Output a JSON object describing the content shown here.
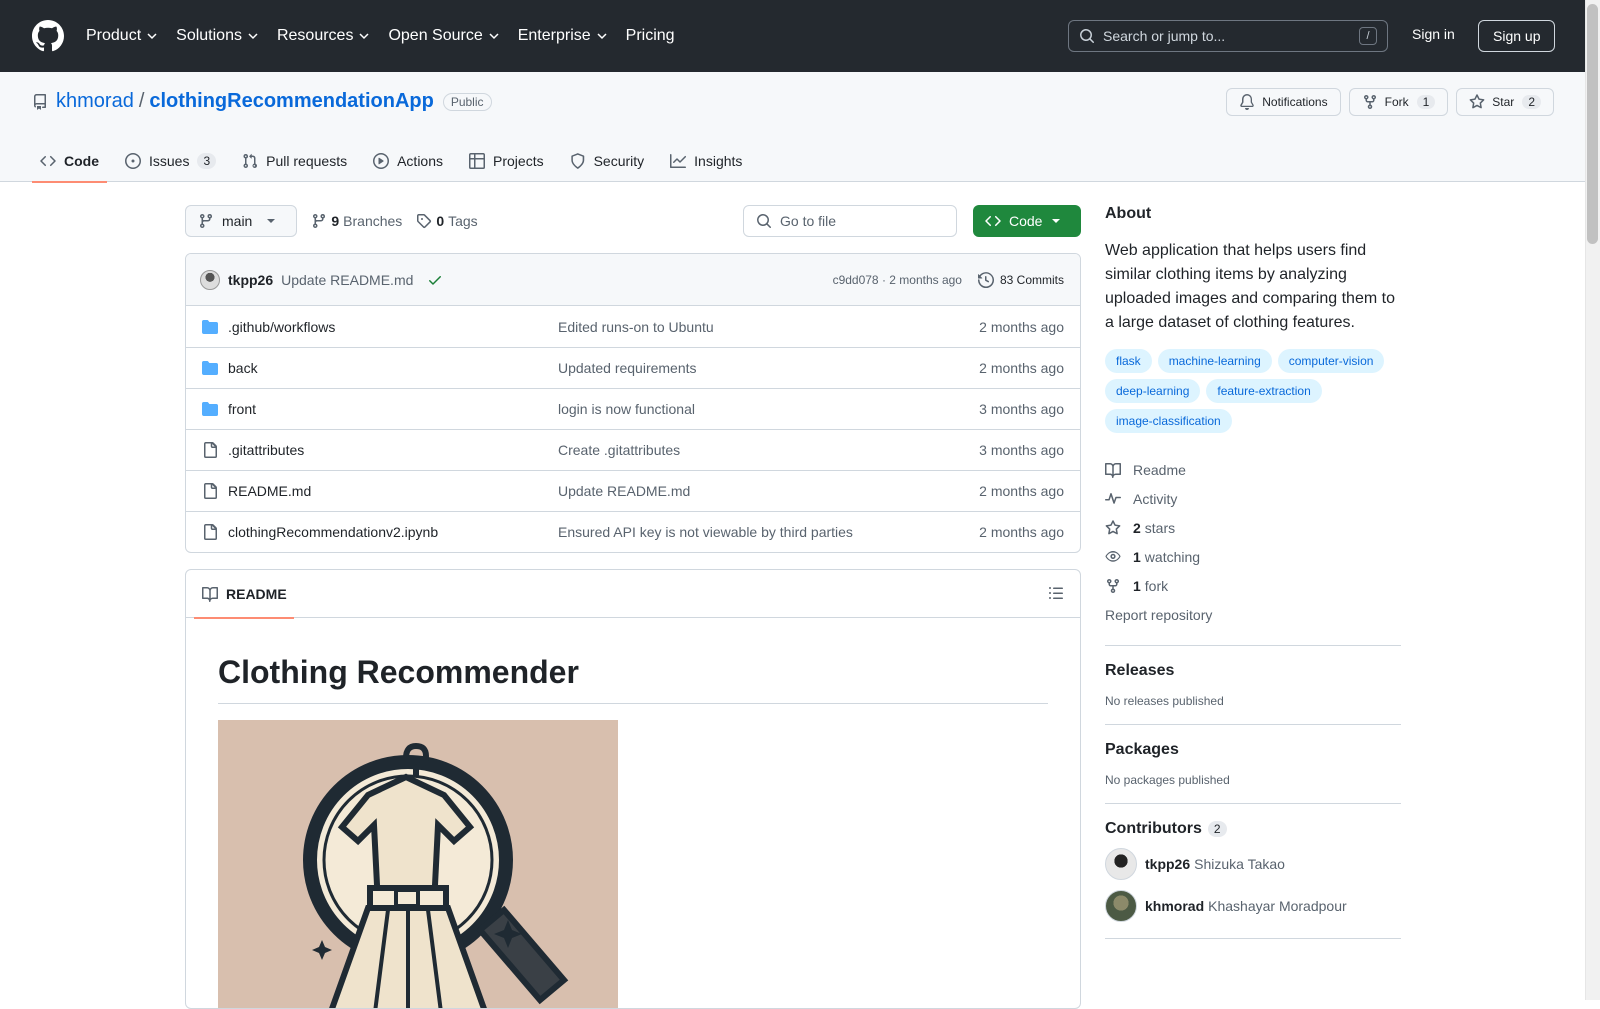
{
  "header": {
    "nav": [
      {
        "label": "Product",
        "dropdown": true
      },
      {
        "label": "Solutions",
        "dropdown": true
      },
      {
        "label": "Resources",
        "dropdown": true
      },
      {
        "label": "Open Source",
        "dropdown": true
      },
      {
        "label": "Enterprise",
        "dropdown": true
      },
      {
        "label": "Pricing",
        "dropdown": false
      }
    ],
    "search_placeholder": "Search or jump to...",
    "search_key": "/",
    "signin": "Sign in",
    "signup": "Sign up"
  },
  "repo": {
    "owner": "khmorad",
    "separator": "/",
    "name": "clothingRecommendationApp",
    "visibility": "Public",
    "notifications_label": "Notifications",
    "fork_label": "Fork",
    "fork_count": "1",
    "star_label": "Star",
    "star_count": "2"
  },
  "tabs": [
    {
      "label": "Code",
      "icon": "code-icon",
      "active": true,
      "count": ""
    },
    {
      "label": "Issues",
      "icon": "issue-icon",
      "active": false,
      "count": "3"
    },
    {
      "label": "Pull requests",
      "icon": "pull-request-icon",
      "active": false,
      "count": ""
    },
    {
      "label": "Actions",
      "icon": "play-icon",
      "active": false,
      "count": ""
    },
    {
      "label": "Projects",
      "icon": "table-icon",
      "active": false,
      "count": ""
    },
    {
      "label": "Security",
      "icon": "shield-icon",
      "active": false,
      "count": ""
    },
    {
      "label": "Insights",
      "icon": "graph-icon",
      "active": false,
      "count": ""
    }
  ],
  "toolbar": {
    "branch": "main",
    "branches_count": "9",
    "branches_label": "Branches",
    "tags_count": "0",
    "tags_label": "Tags",
    "goto_placeholder": "Go to file",
    "code_button": "Code"
  },
  "latest_commit": {
    "author": "tkpp26",
    "message": "Update README.md",
    "hash": "c9dd078",
    "when": "2 months ago",
    "hash_when": "c9dd078 · 2 months ago",
    "commits_label": "83 Commits"
  },
  "files": [
    {
      "name": ".github/workflows",
      "type": "folder",
      "message": "Edited runs-on to Ubuntu",
      "date": "2 months ago"
    },
    {
      "name": "back",
      "type": "folder",
      "message": "Updated requirements",
      "date": "2 months ago"
    },
    {
      "name": "front",
      "type": "folder",
      "message": "login is now functional",
      "date": "3 months ago"
    },
    {
      "name": ".gitattributes",
      "type": "file",
      "message": "Create .gitattributes",
      "date": "3 months ago"
    },
    {
      "name": "README.md",
      "type": "file",
      "message": "Update README.md",
      "date": "2 months ago"
    },
    {
      "name": "clothingRecommendationv2.ipynb",
      "type": "file",
      "message": "Ensured API key is not viewable by third parties",
      "date": "2 months ago"
    }
  ],
  "readme": {
    "tab_label": "README",
    "heading": "Clothing Recommender"
  },
  "about": {
    "title": "About",
    "description": "Web application that helps users find similar clothing items by analyzing uploaded images and comparing them to a large dataset of clothing features.",
    "topics": [
      "flask",
      "machine-learning",
      "computer-vision",
      "deep-learning",
      "feature-extraction",
      "image-classification"
    ],
    "links": [
      {
        "icon": "book-icon",
        "bold": "",
        "label": "Readme"
      },
      {
        "icon": "pulse-icon",
        "bold": "",
        "label": "Activity"
      },
      {
        "icon": "star-icon",
        "bold": "2",
        "label": "stars"
      },
      {
        "icon": "eye-icon",
        "bold": "1",
        "label": "watching"
      },
      {
        "icon": "fork-icon",
        "bold": "1",
        "label": "fork"
      }
    ],
    "report": "Report repository"
  },
  "releases": {
    "title": "Releases",
    "text": "No releases published"
  },
  "packages": {
    "title": "Packages",
    "text": "No packages published"
  },
  "contributors": {
    "title": "Contributors",
    "count": "2",
    "people": [
      {
        "login": "tkpp26",
        "name": "Shizuka Takao"
      },
      {
        "login": "khmorad",
        "name": "Khashayar Moradpour"
      }
    ]
  },
  "colors": {
    "accent": "#0969da",
    "primary_button": "#1f883d",
    "header_bg": "#24292f",
    "tab_underline": "#fd8c73"
  }
}
